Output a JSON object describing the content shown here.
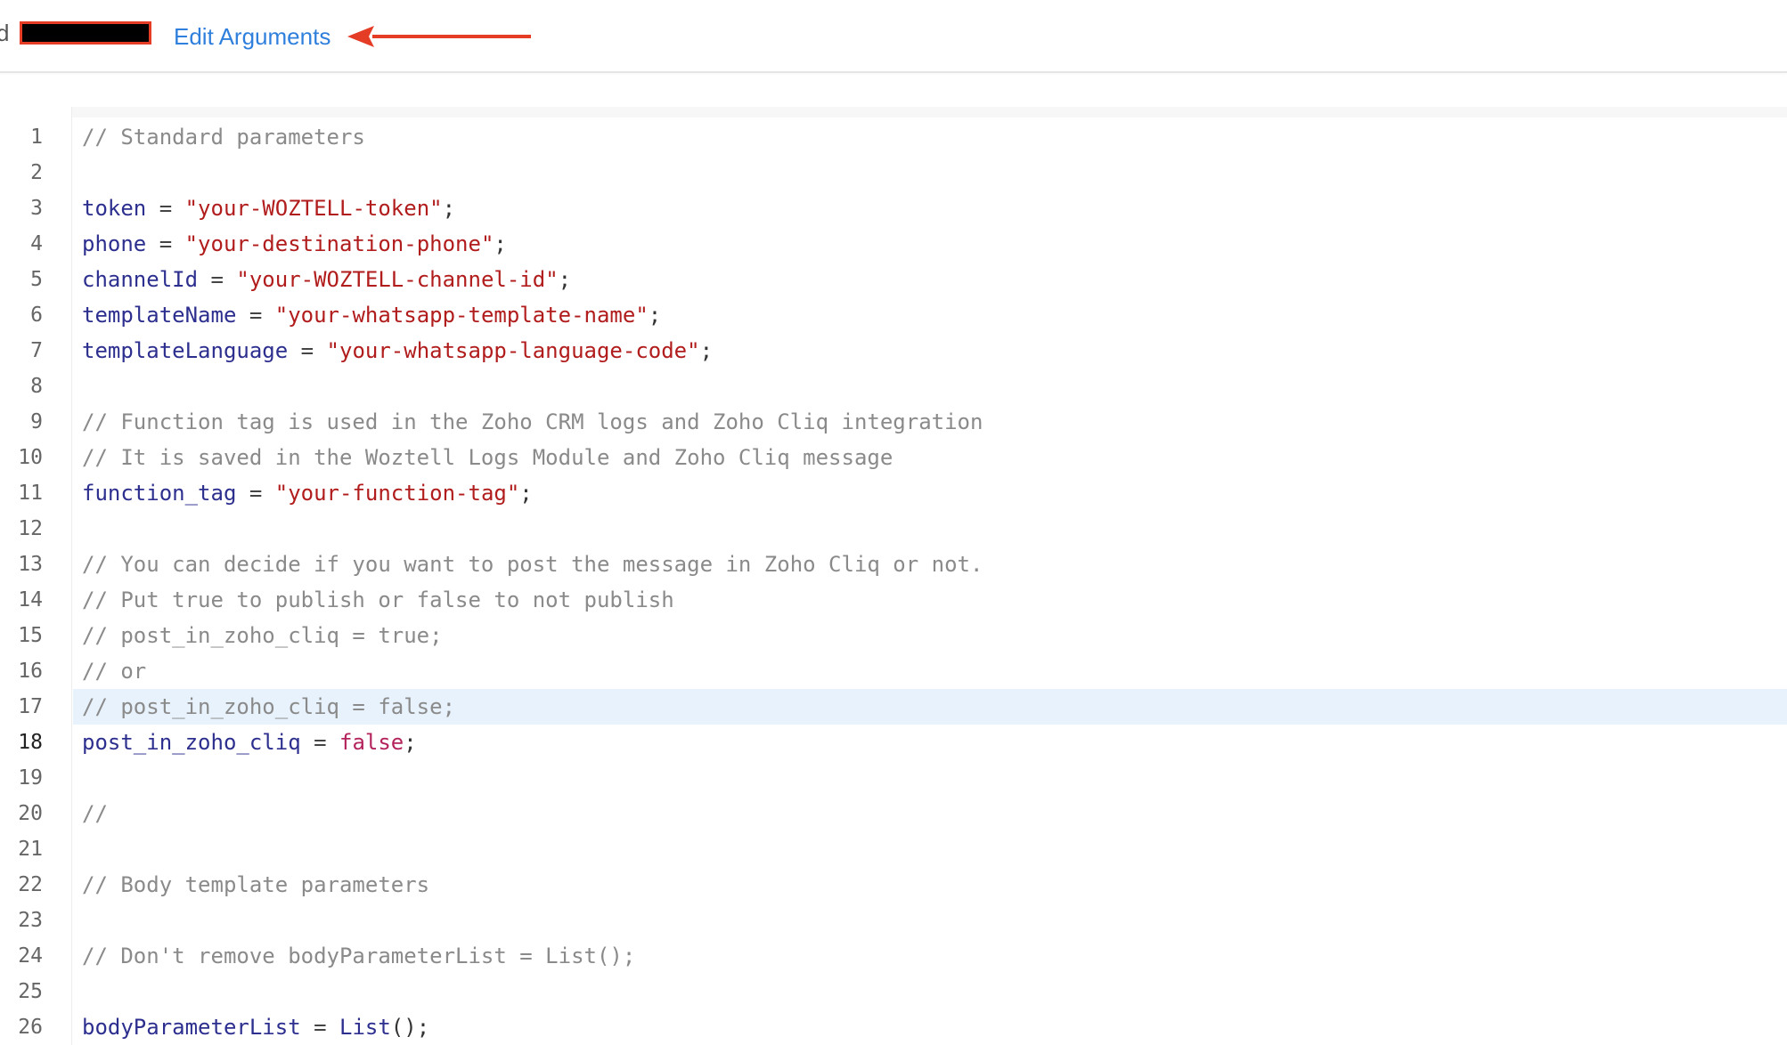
{
  "header": {
    "cut_letter": "d",
    "edit_arguments_label": "Edit Arguments"
  },
  "colors": {
    "link": "#2f7fdc",
    "arrow": "#e53c26",
    "comment": "#8a8a8a",
    "variable": "#2d2f8f",
    "string": "#b11c1c",
    "boolean": "#b4245c",
    "active_line_bg": "#e8f2fc"
  },
  "editor": {
    "active_line": 17,
    "lines": [
      {
        "num": "1",
        "tokens": [
          {
            "t": "comment",
            "v": "// Standard parameters"
          }
        ]
      },
      {
        "num": "2",
        "tokens": []
      },
      {
        "num": "3",
        "tokens": [
          {
            "t": "var",
            "v": "token"
          },
          {
            "t": "op",
            "v": " = "
          },
          {
            "t": "str",
            "v": "\"your-WOZTELL-token\""
          },
          {
            "t": "punc",
            "v": ";"
          }
        ]
      },
      {
        "num": "4",
        "tokens": [
          {
            "t": "var",
            "v": "phone"
          },
          {
            "t": "op",
            "v": " = "
          },
          {
            "t": "str",
            "v": "\"your-destination-phone\""
          },
          {
            "t": "punc",
            "v": ";"
          }
        ]
      },
      {
        "num": "5",
        "tokens": [
          {
            "t": "var",
            "v": "channelId"
          },
          {
            "t": "op",
            "v": " = "
          },
          {
            "t": "str",
            "v": "\"your-WOZTELL-channel-id\""
          },
          {
            "t": "punc",
            "v": ";"
          }
        ]
      },
      {
        "num": "6",
        "tokens": [
          {
            "t": "var",
            "v": "templateName"
          },
          {
            "t": "op",
            "v": " = "
          },
          {
            "t": "str",
            "v": "\"your-whatsapp-template-name\""
          },
          {
            "t": "punc",
            "v": ";"
          }
        ]
      },
      {
        "num": "7",
        "tokens": [
          {
            "t": "var",
            "v": "templateLanguage"
          },
          {
            "t": "op",
            "v": " = "
          },
          {
            "t": "str",
            "v": "\"your-whatsapp-language-code\""
          },
          {
            "t": "punc",
            "v": ";"
          }
        ]
      },
      {
        "num": "8",
        "tokens": []
      },
      {
        "num": "9",
        "tokens": [
          {
            "t": "comment",
            "v": "// Function tag is used in the Zoho CRM logs and Zoho Cliq integration"
          }
        ]
      },
      {
        "num": "10",
        "tokens": [
          {
            "t": "comment",
            "v": "// It is saved in the Woztell Logs Module and Zoho Cliq message"
          }
        ]
      },
      {
        "num": "11",
        "tokens": [
          {
            "t": "var",
            "v": "function_tag"
          },
          {
            "t": "op",
            "v": " = "
          },
          {
            "t": "str",
            "v": "\"your-function-tag\""
          },
          {
            "t": "punc",
            "v": ";"
          }
        ]
      },
      {
        "num": "12",
        "tokens": []
      },
      {
        "num": "13",
        "tokens": [
          {
            "t": "comment",
            "v": "// You can decide if you want to post the message in Zoho Cliq or not."
          }
        ]
      },
      {
        "num": "14",
        "tokens": [
          {
            "t": "comment",
            "v": "// Put true to publish or false to not publish"
          }
        ]
      },
      {
        "num": "15",
        "tokens": [
          {
            "t": "comment",
            "v": "// post_in_zoho_cliq = true;"
          }
        ]
      },
      {
        "num": "16",
        "tokens": [
          {
            "t": "comment",
            "v": "// or"
          }
        ]
      },
      {
        "num": "17",
        "tokens": [
          {
            "t": "comment",
            "v": "// post_in_zoho_cliq = false;"
          }
        ]
      },
      {
        "num": "18",
        "tokens": [
          {
            "t": "var",
            "v": "post_in_zoho_cliq"
          },
          {
            "t": "op",
            "v": " = "
          },
          {
            "t": "bool",
            "v": "false"
          },
          {
            "t": "punc",
            "v": ";"
          }
        ]
      },
      {
        "num": "19",
        "tokens": []
      },
      {
        "num": "20",
        "tokens": [
          {
            "t": "comment",
            "v": "//"
          }
        ]
      },
      {
        "num": "21",
        "tokens": []
      },
      {
        "num": "22",
        "tokens": [
          {
            "t": "comment",
            "v": "// Body template parameters"
          }
        ]
      },
      {
        "num": "23",
        "tokens": []
      },
      {
        "num": "24",
        "tokens": [
          {
            "t": "comment",
            "v": "// Don't remove bodyParameterList = List();"
          }
        ]
      },
      {
        "num": "25",
        "tokens": []
      },
      {
        "num": "26",
        "tokens": [
          {
            "t": "var",
            "v": "bodyParameterList"
          },
          {
            "t": "op",
            "v": " = "
          },
          {
            "t": "fn",
            "v": "List"
          },
          {
            "t": "punc",
            "v": "();"
          }
        ]
      }
    ]
  }
}
